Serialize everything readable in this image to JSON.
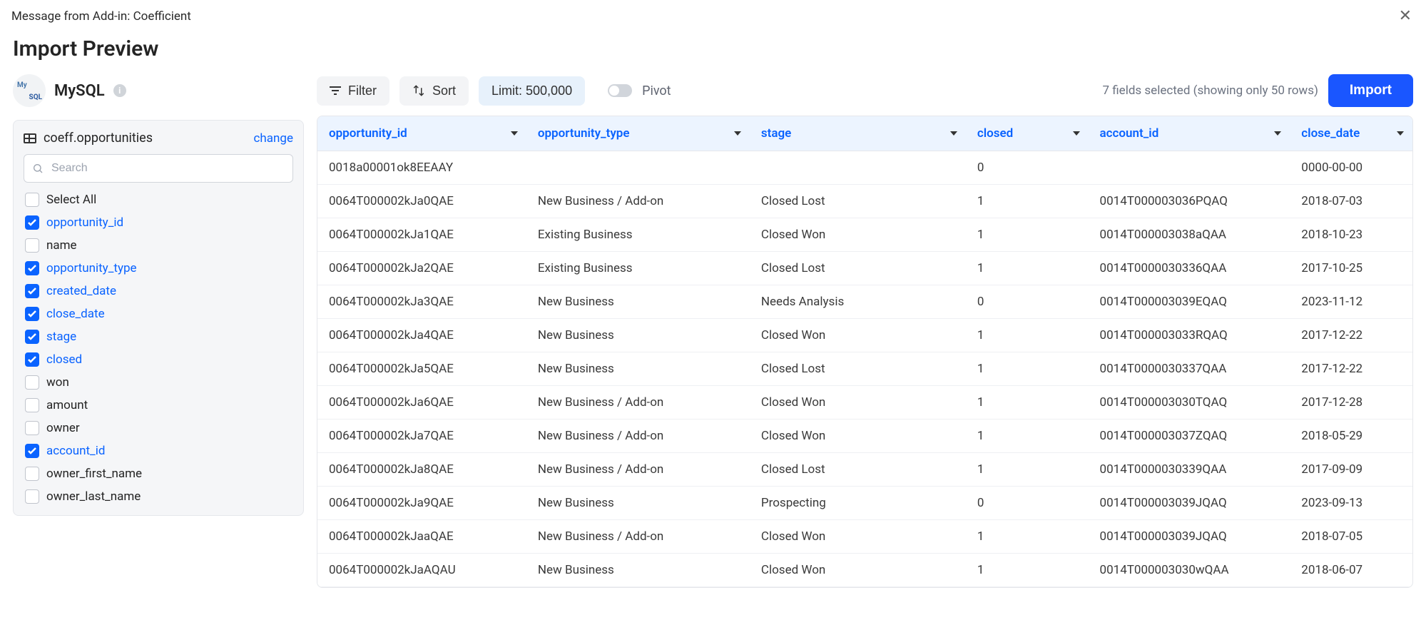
{
  "titlebar": {
    "addin_label": "Message from Add-in: Coefficient"
  },
  "header": {
    "title": "Import Preview"
  },
  "source": {
    "name": "MySQL"
  },
  "sidebar": {
    "table_name": "coeff.opportunities",
    "change_label": "change",
    "search_placeholder": "Search"
  },
  "fields": [
    {
      "label": "Select All",
      "checked": false
    },
    {
      "label": "opportunity_id",
      "checked": true
    },
    {
      "label": "name",
      "checked": false
    },
    {
      "label": "opportunity_type",
      "checked": true
    },
    {
      "label": "created_date",
      "checked": true
    },
    {
      "label": "close_date",
      "checked": true
    },
    {
      "label": "stage",
      "checked": true
    },
    {
      "label": "closed",
      "checked": true
    },
    {
      "label": "won",
      "checked": false
    },
    {
      "label": "amount",
      "checked": false
    },
    {
      "label": "owner",
      "checked": false
    },
    {
      "label": "account_id",
      "checked": true
    },
    {
      "label": "owner_first_name",
      "checked": false
    },
    {
      "label": "owner_last_name",
      "checked": false
    }
  ],
  "toolbar": {
    "filter": "Filter",
    "sort": "Sort",
    "limit": "Limit: 500,000",
    "pivot": "Pivot",
    "status": "7 fields selected (showing only 50 rows)",
    "import": "Import"
  },
  "columns": [
    {
      "key": "opportunity_id",
      "label": "opportunity_id",
      "cls": "col-opp"
    },
    {
      "key": "opportunity_type",
      "label": "opportunity_type",
      "cls": "col-type"
    },
    {
      "key": "stage",
      "label": "stage",
      "cls": "col-stage"
    },
    {
      "key": "closed",
      "label": "closed",
      "cls": "col-closed"
    },
    {
      "key": "account_id",
      "label": "account_id",
      "cls": "col-acct"
    },
    {
      "key": "close_date",
      "label": "close_date",
      "cls": "col-date"
    }
  ],
  "rows": [
    {
      "opportunity_id": "0018a00001ok8EEAAY",
      "opportunity_type": "",
      "stage": "",
      "closed": "0",
      "account_id": "",
      "close_date": "0000-00-00"
    },
    {
      "opportunity_id": "0064T000002kJa0QAE",
      "opportunity_type": "New Business / Add-on",
      "stage": "Closed Lost",
      "closed": "1",
      "account_id": "0014T000003036PQAQ",
      "close_date": "2018-07-03"
    },
    {
      "opportunity_id": "0064T000002kJa1QAE",
      "opportunity_type": "Existing Business",
      "stage": "Closed Won",
      "closed": "1",
      "account_id": "0014T000003038aQAA",
      "close_date": "2018-10-23"
    },
    {
      "opportunity_id": "0064T000002kJa2QAE",
      "opportunity_type": "Existing Business",
      "stage": "Closed Lost",
      "closed": "1",
      "account_id": "0014T0000030336QAA",
      "close_date": "2017-10-25"
    },
    {
      "opportunity_id": "0064T000002kJa3QAE",
      "opportunity_type": "New Business",
      "stage": "Needs Analysis",
      "closed": "0",
      "account_id": "0014T000003039EQAQ",
      "close_date": "2023-11-12"
    },
    {
      "opportunity_id": "0064T000002kJa4QAE",
      "opportunity_type": "New Business",
      "stage": "Closed Won",
      "closed": "1",
      "account_id": "0014T000003033RQAQ",
      "close_date": "2017-12-22"
    },
    {
      "opportunity_id": "0064T000002kJa5QAE",
      "opportunity_type": "New Business",
      "stage": "Closed Lost",
      "closed": "1",
      "account_id": "0014T0000030337QAA",
      "close_date": "2017-12-22"
    },
    {
      "opportunity_id": "0064T000002kJa6QAE",
      "opportunity_type": "New Business / Add-on",
      "stage": "Closed Won",
      "closed": "1",
      "account_id": "0014T000003030TQAQ",
      "close_date": "2017-12-28"
    },
    {
      "opportunity_id": "0064T000002kJa7QAE",
      "opportunity_type": "New Business / Add-on",
      "stage": "Closed Won",
      "closed": "1",
      "account_id": "0014T000003037ZQAQ",
      "close_date": "2018-05-29"
    },
    {
      "opportunity_id": "0064T000002kJa8QAE",
      "opportunity_type": "New Business / Add-on",
      "stage": "Closed Lost",
      "closed": "1",
      "account_id": "0014T0000030339QAA",
      "close_date": "2017-09-09"
    },
    {
      "opportunity_id": "0064T000002kJa9QAE",
      "opportunity_type": "New Business",
      "stage": "Prospecting",
      "closed": "0",
      "account_id": "0014T000003039JQAQ",
      "close_date": "2023-09-13"
    },
    {
      "opportunity_id": "0064T000002kJaaQAE",
      "opportunity_type": "New Business / Add-on",
      "stage": "Closed Won",
      "closed": "1",
      "account_id": "0014T000003039JQAQ",
      "close_date": "2018-07-05"
    },
    {
      "opportunity_id": "0064T000002kJaAQAU",
      "opportunity_type": "New Business",
      "stage": "Closed Won",
      "closed": "1",
      "account_id": "0014T000003030wQAA",
      "close_date": "2018-06-07"
    }
  ]
}
